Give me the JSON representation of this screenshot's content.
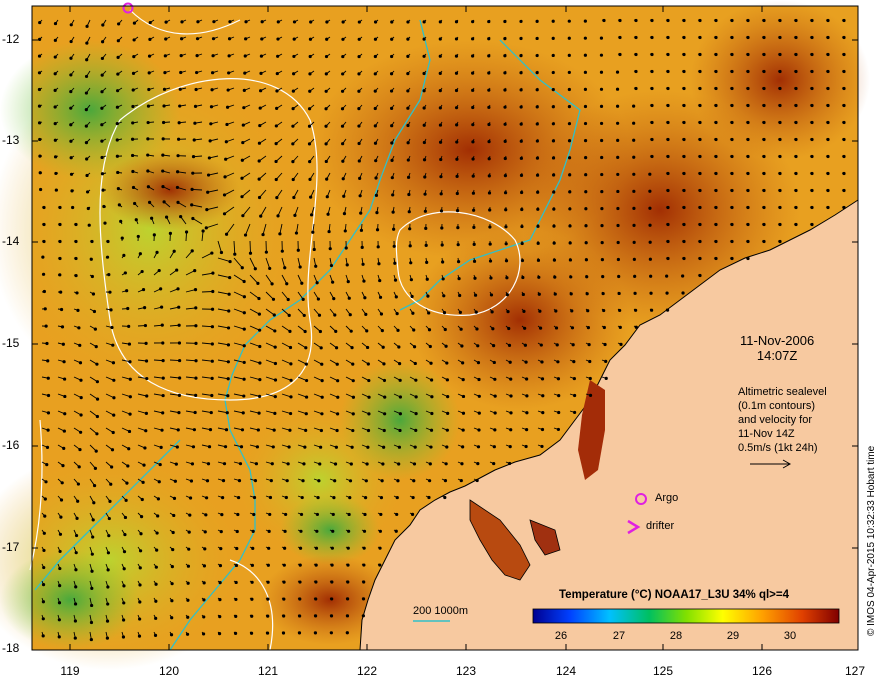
{
  "map": {
    "y_axis_ticks": [
      "-12",
      "-13",
      "-14",
      "-15",
      "-16",
      "-17",
      "-18"
    ],
    "x_axis_ticks": [
      "119",
      "120",
      "121",
      "122",
      "123",
      "124",
      "125",
      "126",
      "127"
    ],
    "date_line1": "11-Nov-2006",
    "date_line2": "14:07Z",
    "note_lines": [
      "Altimetric sealevel",
      "(0.1m contours)",
      "and velocity for",
      "11-Nov 14Z",
      "0.5m/s (1kt 24h)"
    ],
    "argo_label": "Argo",
    "drifter_label": "drifter",
    "scale_label": "200  1000m",
    "colorbar_title": "Temperature (°C) NOAA17_L3U 34% ql>=4",
    "colorbar_ticks": [
      "26",
      "27",
      "28",
      "29",
      "30"
    ],
    "timestamp": "© IMOS 04-Apr-2015 10:32:33 Hobart time"
  },
  "colors": {
    "land": "#f7c9a0",
    "sst_warm": "#c05a10",
    "sst_hot": "#8a1800",
    "sst_mid": "#e8a020",
    "sst_cool": "#c8d820",
    "sst_cold": "#40b040",
    "isobath": "#30c0c8",
    "contour": "#ffffff",
    "argo": "#e020e0"
  }
}
